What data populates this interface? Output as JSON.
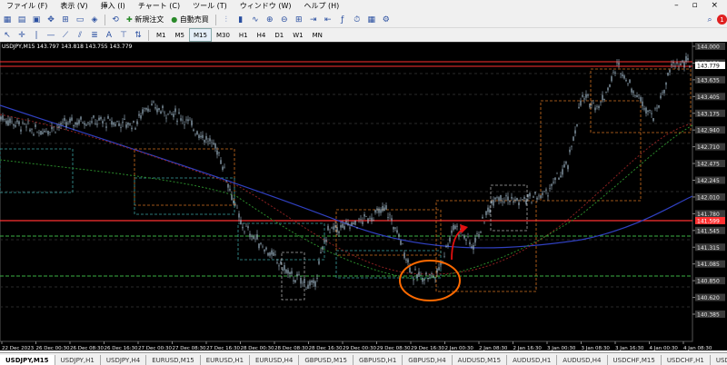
{
  "menu": [
    "ファイル (F)",
    "表示 (V)",
    "挿入 (I)",
    "チャート (C)",
    "ツール (T)",
    "ウィンドウ (W)",
    "ヘルプ (H)"
  ],
  "toolbar": {
    "new_order": "新規注文",
    "auto_trade": "自動売買",
    "alert_count": "1"
  },
  "timeframes": [
    "M1",
    "M5",
    "M15",
    "M30",
    "H1",
    "H4",
    "D1",
    "W1",
    "MN"
  ],
  "active_timeframe": "M15",
  "chart": {
    "symbol_info": "USDJPY,M15  143.797 143.818 143.755 143.779",
    "current_price": "143.779",
    "red_line_price": "141.599",
    "price_labels": [
      "144.000",
      "143.870",
      "143.635",
      "143.405",
      "143.175",
      "142.940",
      "142.710",
      "142.475",
      "142.245",
      "142.010",
      "141.780",
      "141.545",
      "141.315",
      "141.085",
      "140.850",
      "140.620",
      "140.385"
    ],
    "time_labels": [
      "22 Dec 2023",
      "26 Dec 00:30",
      "26 Dec 08:30",
      "26 Dec 16:30",
      "27 Dec 00:30",
      "27 Dec 08:30",
      "27 Dec 16:30",
      "28 Dec 00:30",
      "28 Dec 08:30",
      "28 Dec 16:30",
      "29 Dec 00:30",
      "29 Dec 08:30",
      "29 Dec 16:30",
      "2 Jan 00:30",
      "2 Jan 08:30",
      "2 Jan 16:30",
      "3 Jan 00:30",
      "3 Jan 08:30",
      "3 Jan 16:30",
      "4 Jan 00:30",
      "4 Jan 08:30"
    ],
    "colors": {
      "background": "#000000",
      "candle": "#9fb7c8",
      "annotation": "#ff6a00",
      "resistance": "#ff3030",
      "support": "#3cb043"
    }
  },
  "tabs": [
    "USDJPY,M15",
    "USDJPY,H1",
    "USDJPY,H4",
    "EURUSD,M15",
    "EURUSD,H1",
    "EURUSD,H4",
    "GBPUSD,M15",
    "GBPUSD,H1",
    "GBPUSD,H4",
    "AUDUSD,M15",
    "AUDUSD,H1",
    "AUDUSD,H4",
    "USDCHF,M15",
    "USDCHF,H1",
    "USDCHF,H4"
  ],
  "active_tab": "USDJPY,M15"
}
